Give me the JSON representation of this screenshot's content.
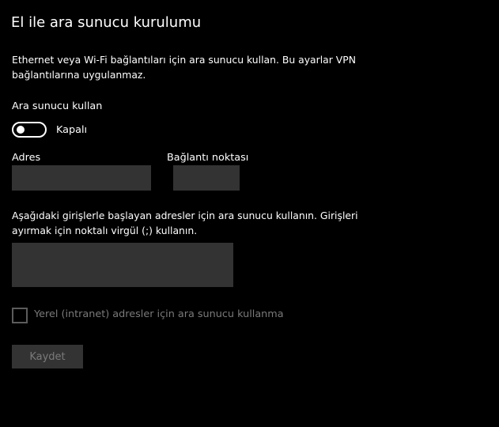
{
  "page": {
    "title": "El ile ara sunucu kurulumu",
    "description": "Ethernet veya Wi-Fi bağlantıları için ara sunucu kullan. Bu ayarlar VPN bağlantılarına uygulanmaz."
  },
  "proxy": {
    "label": "Ara sunucu kullan",
    "toggle_state": "Kapalı",
    "toggle_on": false
  },
  "address": {
    "label": "Adres",
    "value": ""
  },
  "port": {
    "label": "Bağlantı noktası",
    "value": ""
  },
  "exceptions": {
    "description": "Aşağıdaki girişlerle başlayan adresler için ara sunucu kullanın. Girişleri ayırmak için noktalı virgül (;) kullanın.",
    "value": ""
  },
  "local_bypass": {
    "label": "Yerel (intranet) adresler için ara sunucu kullanma",
    "checked": false,
    "enabled": false
  },
  "save_button": {
    "label": "Kaydet",
    "enabled": false
  },
  "colors": {
    "background": "#000000",
    "text": "#ffffff",
    "field": "#333333",
    "disabled_text": "#7a7a7a"
  }
}
